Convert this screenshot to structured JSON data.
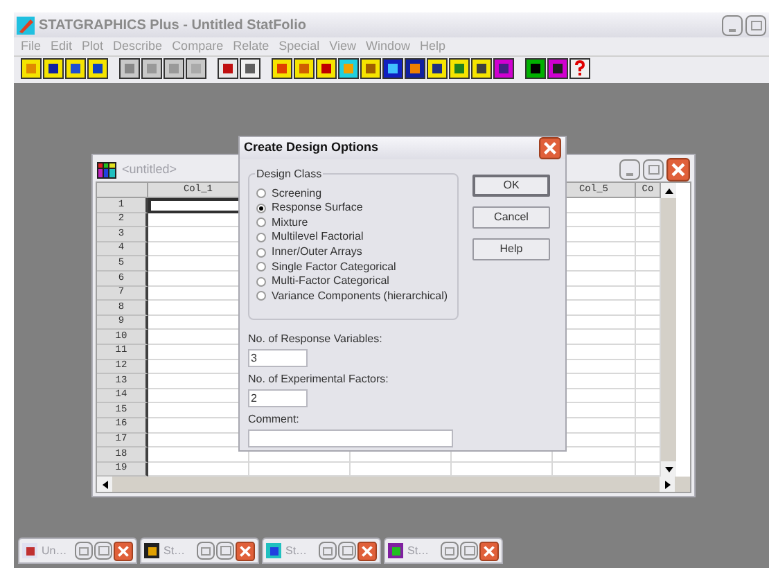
{
  "app": {
    "title": "STATGRAPHICS Plus - Untitled StatFolio"
  },
  "menu": [
    "File",
    "Edit",
    "Plot",
    "Describe",
    "Compare",
    "Relate",
    "Special",
    "View",
    "Window",
    "Help"
  ],
  "spreadsheet": {
    "title": "<untitled>",
    "columns": [
      "Col_1",
      "Col_5",
      "Co"
    ],
    "rows": [
      "1",
      "2",
      "3",
      "4",
      "5",
      "6",
      "7",
      "8",
      "9",
      "10",
      "11",
      "12",
      "13",
      "14",
      "15",
      "16",
      "17",
      "18",
      "19"
    ]
  },
  "dialog": {
    "title": "Create Design Options",
    "group_title": "Design Class",
    "options": [
      {
        "label": "Screening",
        "selected": false
      },
      {
        "label": "Response Surface",
        "selected": true
      },
      {
        "label": "Mixture",
        "selected": false
      },
      {
        "label": "Multilevel Factorial",
        "selected": false
      },
      {
        "label": "Inner/Outer Arrays",
        "selected": false
      },
      {
        "label": "Single Factor Categorical",
        "selected": false
      },
      {
        "label": "Multi-Factor Categorical",
        "selected": false
      },
      {
        "label": "Variance Components (hierarchical)",
        "selected": false
      }
    ],
    "fields": [
      {
        "label": "No. of Response Variables:",
        "value": "3",
        "kind": "short"
      },
      {
        "label": "No. of Experimental Factors:",
        "value": "2",
        "kind": "short"
      },
      {
        "label": "Comment:",
        "kind": "long"
      }
    ],
    "buttons": [
      "OK",
      "Cancel",
      "Help"
    ]
  },
  "minimized": [
    {
      "title": "Un…"
    },
    {
      "title": "St…"
    },
    {
      "title": "St…"
    },
    {
      "title": "St…"
    }
  ]
}
